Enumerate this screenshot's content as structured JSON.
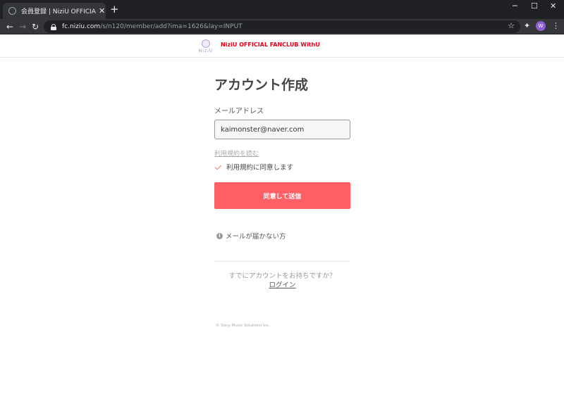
{
  "browser": {
    "tab_title": "会員登録 | NiziU OFFICIAL FANCL",
    "tab_close": "✕",
    "new_tab": "+",
    "url_host": "fc.niziu.com",
    "url_path": "/s/n120/member/add?ima=1626&lay=INPUT",
    "profile_initial": "W",
    "window_minimize": "─",
    "window_maximize": "☐",
    "window_close": "✕",
    "icons": {
      "back": "arrow-left-icon",
      "forward": "arrow-right-icon",
      "reload": "reload-icon",
      "star": "star-icon",
      "extensions": "puzzle-icon",
      "menu": "kebab-menu-icon"
    }
  },
  "site": {
    "logo_text": "NiziU",
    "title": "NiziU OFFICIAL FANCLUB WithU",
    "title_color": "#e3001b"
  },
  "form": {
    "heading": "アカウント作成",
    "email_label": "メールアドレス",
    "email_value": "kaimonster@naver.com",
    "terms_link": "利用規約を読む",
    "agree_label": "利用規約に同意します",
    "submit_label": "同意して送信",
    "submit_color": "#ff5f65",
    "no_mail": "メールが届かない方",
    "have_account": "すでにアカウントをお持ちですか？",
    "login_link": "ログイン"
  },
  "footer": {
    "copyright": "© Sony Music Solutions Inc."
  }
}
